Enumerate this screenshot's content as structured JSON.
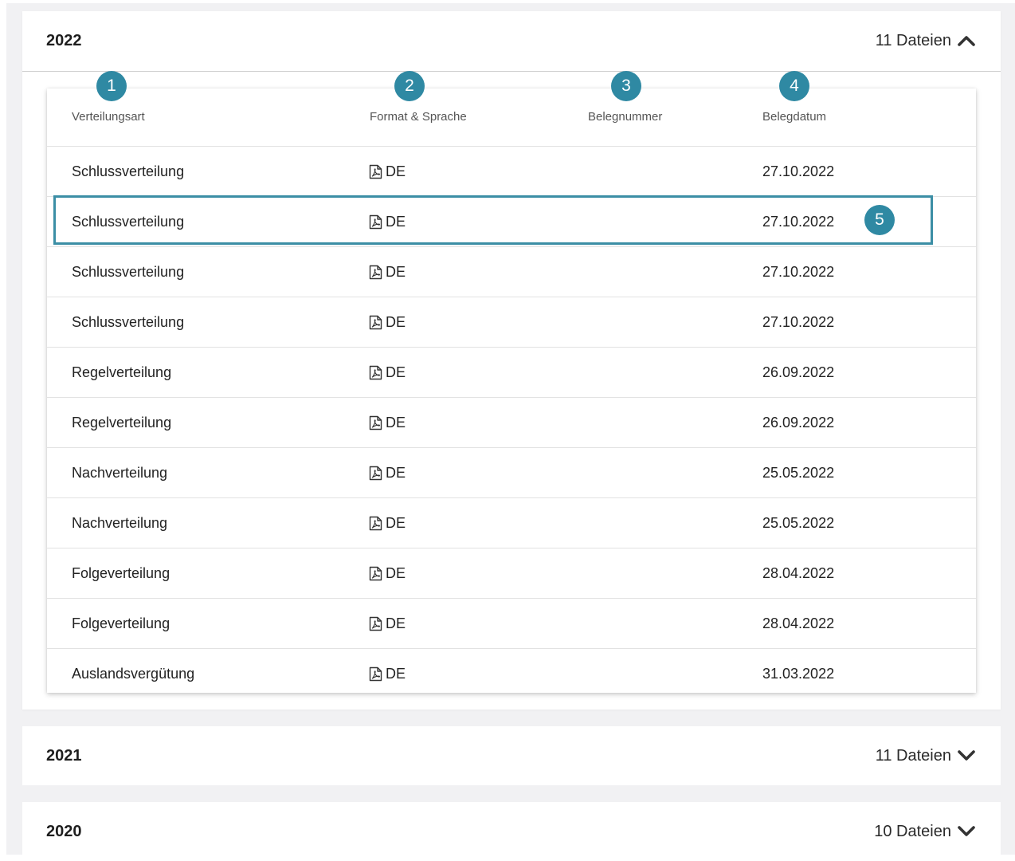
{
  "sections": [
    {
      "year": "2022",
      "count": "11 Dateien",
      "expanded": true
    },
    {
      "year": "2021",
      "count": "11 Dateien",
      "expanded": false
    },
    {
      "year": "2020",
      "count": "10 Dateien",
      "expanded": false
    }
  ],
  "table": {
    "headers": [
      "Verteilungsart",
      "Format & Sprache",
      "Belegnummer",
      "Belegdatum"
    ],
    "rows": [
      {
        "type": "Schlussverteilung",
        "format_icon": "pdf-icon",
        "language": "DE",
        "number": "",
        "date": "27.10.2022"
      },
      {
        "type": "Schlussverteilung",
        "format_icon": "pdf-icon",
        "language": "DE",
        "number": "",
        "date": "27.10.2022"
      },
      {
        "type": "Schlussverteilung",
        "format_icon": "pdf-icon",
        "language": "DE",
        "number": "",
        "date": "27.10.2022"
      },
      {
        "type": "Schlussverteilung",
        "format_icon": "pdf-icon",
        "language": "DE",
        "number": "",
        "date": "27.10.2022"
      },
      {
        "type": "Regelverteilung",
        "format_icon": "pdf-icon",
        "language": "DE",
        "number": "",
        "date": "26.09.2022"
      },
      {
        "type": "Regelverteilung",
        "format_icon": "pdf-icon",
        "language": "DE",
        "number": "",
        "date": "26.09.2022"
      },
      {
        "type": "Nachverteilung",
        "format_icon": "pdf-icon",
        "language": "DE",
        "number": "",
        "date": "25.05.2022"
      },
      {
        "type": "Nachverteilung",
        "format_icon": "pdf-icon",
        "language": "DE",
        "number": "",
        "date": "25.05.2022"
      },
      {
        "type": "Folgeverteilung",
        "format_icon": "pdf-icon",
        "language": "DE",
        "number": "",
        "date": "28.04.2022"
      },
      {
        "type": "Folgeverteilung",
        "format_icon": "pdf-icon",
        "language": "DE",
        "number": "",
        "date": "28.04.2022"
      },
      {
        "type": "Auslandsvergütung",
        "format_icon": "pdf-icon",
        "language": "DE",
        "number": "",
        "date": "31.03.2022"
      }
    ]
  },
  "callouts": [
    "1",
    "2",
    "3",
    "4",
    "5"
  ],
  "highlighted_row": 1,
  "colors": {
    "accent": "#2f89a3",
    "highlight_border": "#3b8ea5",
    "page_background": "#f1f1f3"
  }
}
